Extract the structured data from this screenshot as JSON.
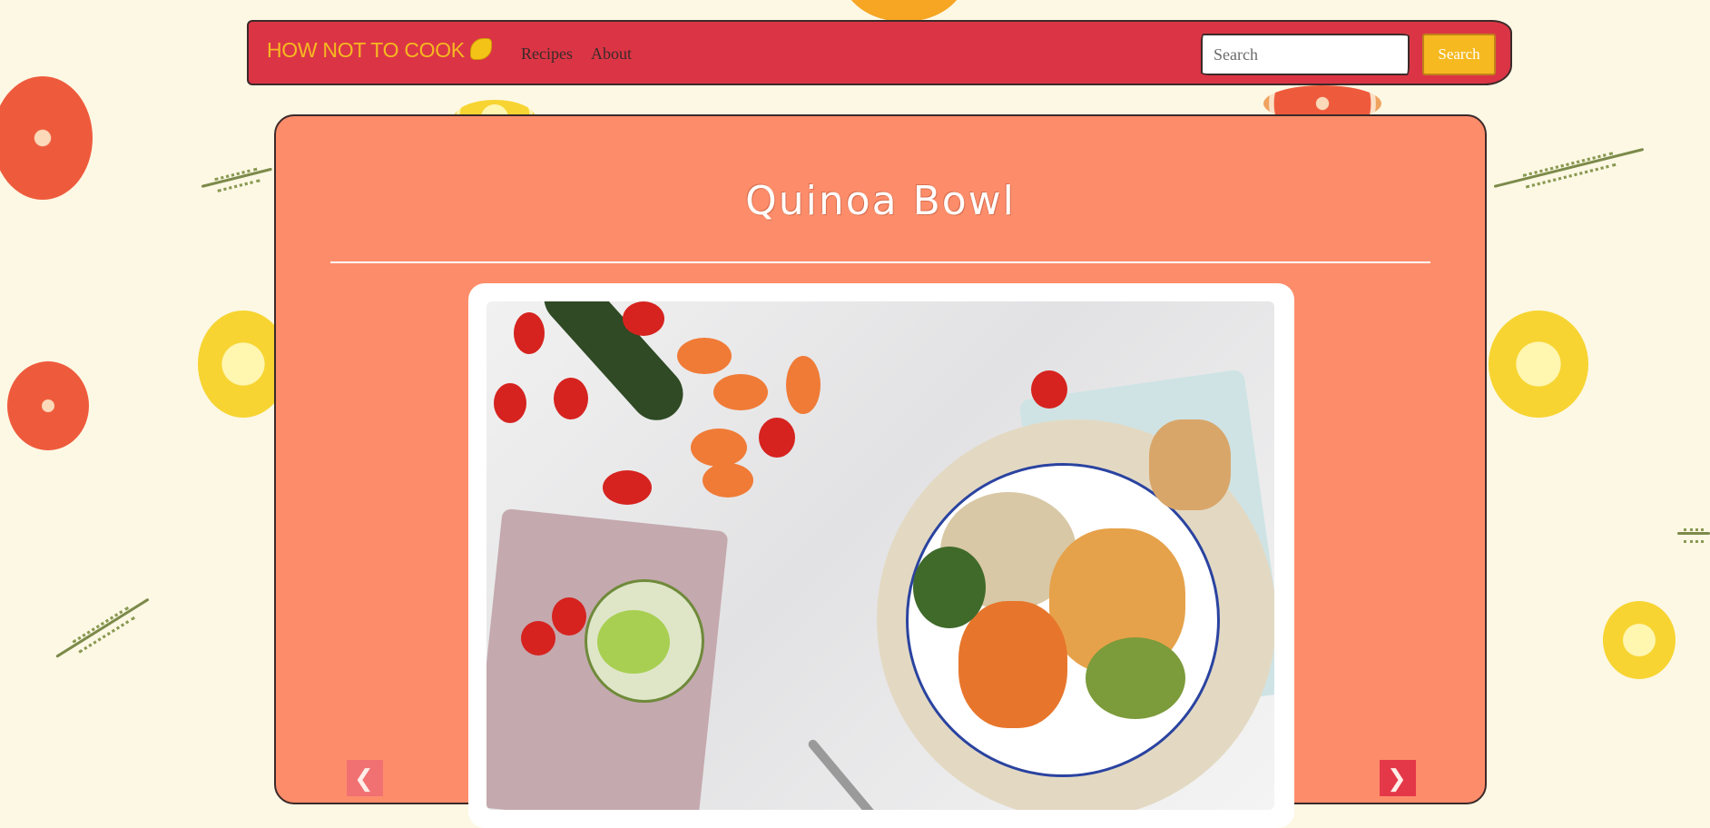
{
  "navbar": {
    "brand": "HOW NOT TO COOK",
    "links": [
      "Recipes",
      "About"
    ],
    "search": {
      "placeholder": "Search",
      "button_label": "Search"
    }
  },
  "recipe": {
    "title": "Quinoa Bowl",
    "image_description_icon": "food-photo"
  },
  "colors": {
    "navbar": "#db3545",
    "brand_text": "#f6b91f",
    "card": "#fd8d6a",
    "page_bg": "#fdf8e4",
    "search_button": "#f6b91f"
  }
}
